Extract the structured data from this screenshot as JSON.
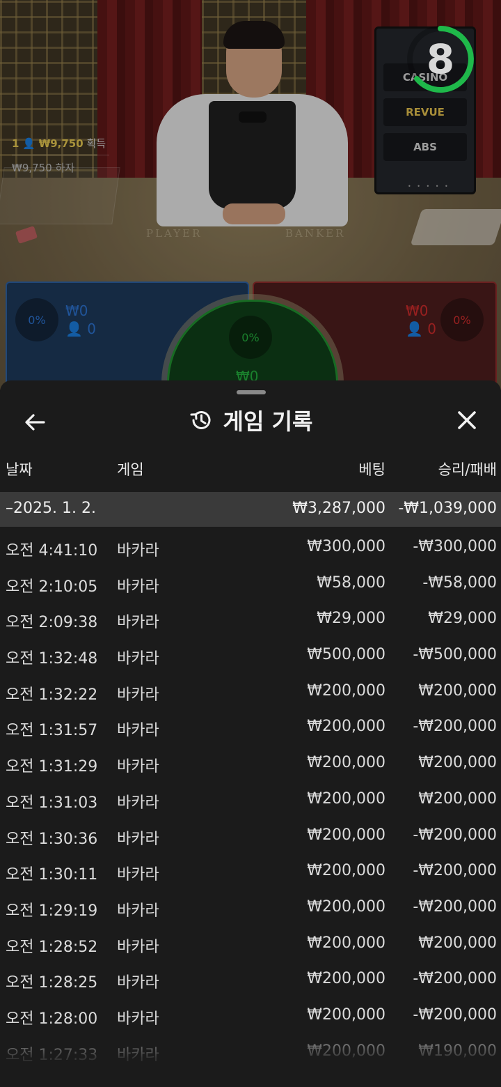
{
  "stream": {
    "countdown": "8",
    "winner_rank": "1",
    "winner_amount": "₩9,750",
    "winner_label": "획득",
    "seat_amount": "₩9,750",
    "seat_label": "하자",
    "table_labels": {
      "player": "PLAYER",
      "banker": "BANKER"
    },
    "sign_rows": [
      "CASINO",
      "REVUE",
      "ABS"
    ],
    "sign_dots": "• • • • •"
  },
  "bet_spots": {
    "player": {
      "percent": "0%",
      "amount": "₩0",
      "players": "0",
      "color": "#2a6cc4"
    },
    "banker": {
      "percent": "0%",
      "amount": "₩0",
      "players": "0",
      "color": "#c42a2a"
    },
    "tie": {
      "percent": "0%",
      "amount": "₩0",
      "color": "#22a63a"
    }
  },
  "history": {
    "title": "게임 기록",
    "columns": {
      "date": "날짜",
      "game": "게임",
      "bet": "베팅",
      "result": "승리/패배"
    },
    "group": {
      "date": "2025. 1. 2.",
      "bet_total": "₩3,287,000",
      "result_total": "-₩1,039,000"
    },
    "rows": [
      {
        "time": "오전 4:41:10",
        "game": "바카라",
        "bet": "₩300,000",
        "result": "-₩300,000"
      },
      {
        "time": "오전 2:10:05",
        "game": "바카라",
        "bet": "₩58,000",
        "result": "-₩58,000"
      },
      {
        "time": "오전 2:09:38",
        "game": "바카라",
        "bet": "₩29,000",
        "result": "₩29,000"
      },
      {
        "time": "오전 1:32:48",
        "game": "바카라",
        "bet": "₩500,000",
        "result": "-₩500,000"
      },
      {
        "time": "오전 1:32:22",
        "game": "바카라",
        "bet": "₩200,000",
        "result": "₩200,000"
      },
      {
        "time": "오전 1:31:57",
        "game": "바카라",
        "bet": "₩200,000",
        "result": "-₩200,000"
      },
      {
        "time": "오전 1:31:29",
        "game": "바카라",
        "bet": "₩200,000",
        "result": "₩200,000"
      },
      {
        "time": "오전 1:31:03",
        "game": "바카라",
        "bet": "₩200,000",
        "result": "₩200,000"
      },
      {
        "time": "오전 1:30:36",
        "game": "바카라",
        "bet": "₩200,000",
        "result": "-₩200,000"
      },
      {
        "time": "오전 1:30:11",
        "game": "바카라",
        "bet": "₩200,000",
        "result": "-₩200,000"
      },
      {
        "time": "오전 1:29:19",
        "game": "바카라",
        "bet": "₩200,000",
        "result": "-₩200,000"
      },
      {
        "time": "오전 1:28:52",
        "game": "바카라",
        "bet": "₩200,000",
        "result": "₩200,000"
      },
      {
        "time": "오전 1:28:25",
        "game": "바카라",
        "bet": "₩200,000",
        "result": "-₩200,000"
      },
      {
        "time": "오전 1:28:00",
        "game": "바카라",
        "bet": "₩200,000",
        "result": "-₩200,000"
      },
      {
        "time": "오전 1:27:33",
        "game": "바카라",
        "bet": "₩200,000",
        "result": "₩190,000"
      }
    ]
  }
}
